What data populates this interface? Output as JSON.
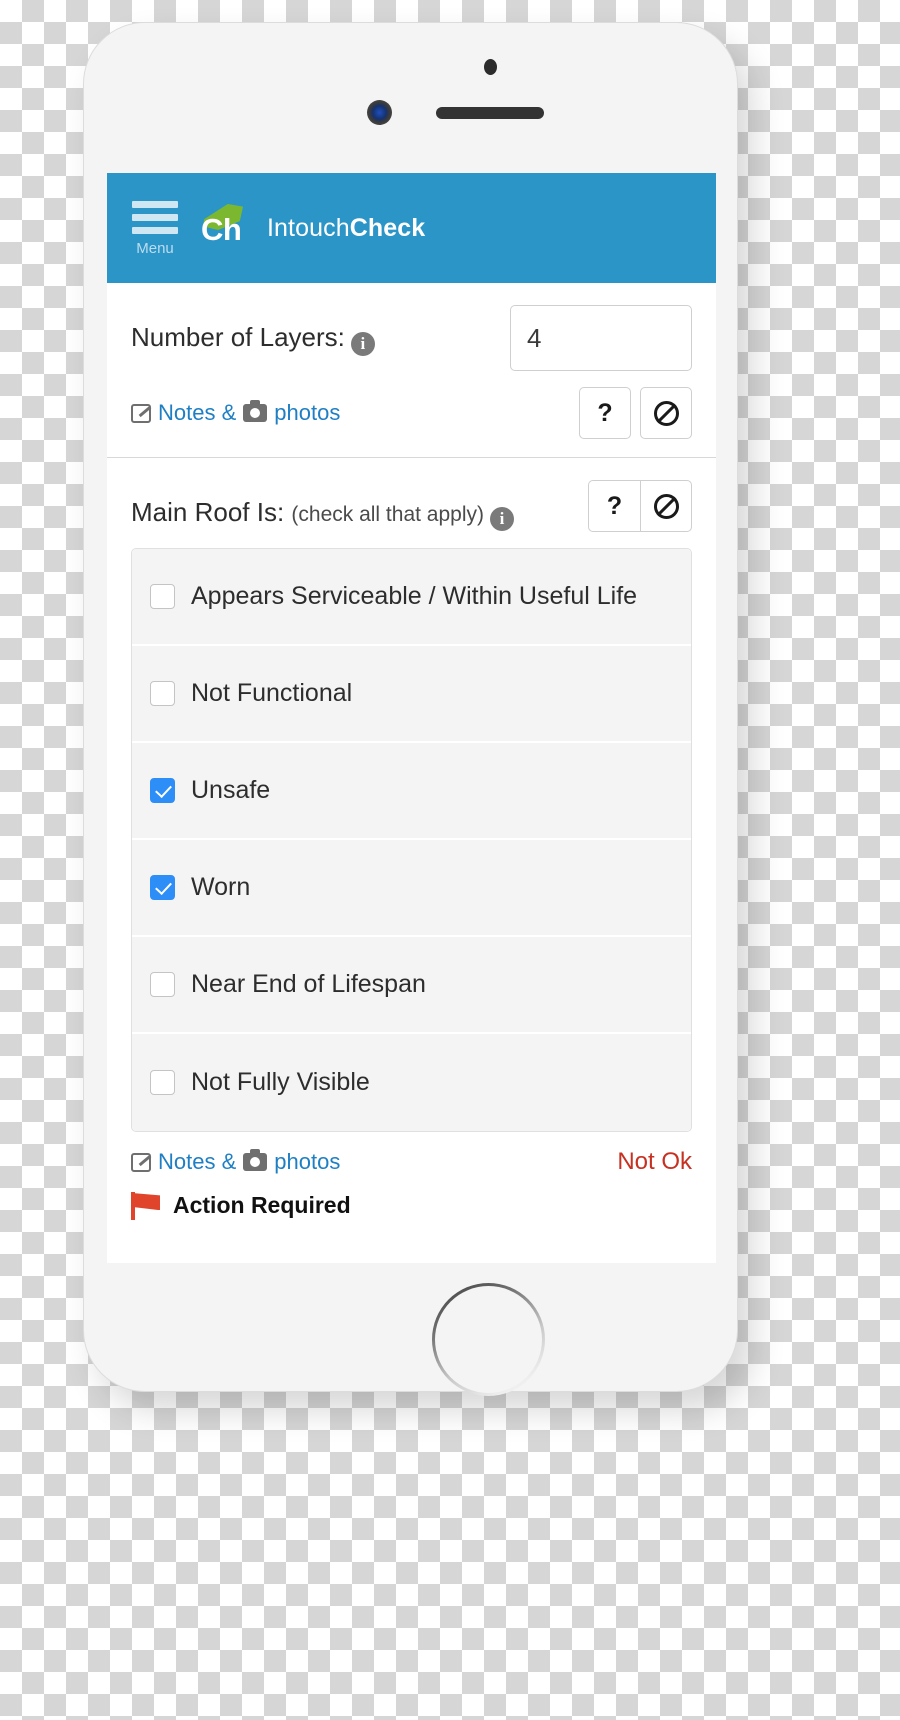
{
  "app": {
    "menu_label": "Menu",
    "logo_text": "Ch",
    "brand_prefix": "Intouch",
    "brand_suffix": "Check"
  },
  "sections": [
    {
      "question": "Number of Layers:",
      "info_icon": "info-icon",
      "input_value": "4",
      "notes_label_a": "Notes &",
      "notes_label_b": "photos",
      "help_button": "?",
      "na_button": "ban-icon"
    },
    {
      "question": "Main Roof Is:",
      "hint": "(check all that apply)",
      "info_icon": "info-icon",
      "help_button": "?",
      "na_button": "ban-icon",
      "options": [
        {
          "label": "Appears Serviceable / Within Useful Life",
          "checked": false
        },
        {
          "label": "Not Functional",
          "checked": false
        },
        {
          "label": "Unsafe",
          "checked": true
        },
        {
          "label": "Worn",
          "checked": true
        },
        {
          "label": "Near End of Lifespan",
          "checked": false
        },
        {
          "label": "Not Fully Visible",
          "checked": false
        }
      ],
      "notes_label_a": "Notes &",
      "notes_label_b": "photos",
      "status_label": "Not Ok",
      "action_label": "Action Required",
      "flag_icon": "flag-icon"
    }
  ],
  "colors": {
    "header_blue": "#2b95c8",
    "link_blue": "#1f7fc4",
    "checkbox_blue": "#2e8ef7",
    "status_red": "#c63122",
    "flag_red": "#e0442b",
    "logo_green": "#7cb82f"
  }
}
